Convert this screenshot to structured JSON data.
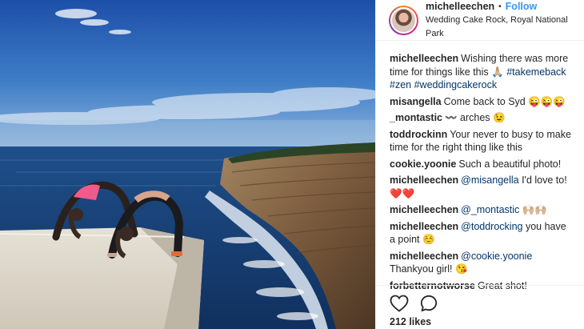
{
  "user": {
    "username": "michelleechen",
    "separator": "•",
    "follow_label": "Follow",
    "location": "Wedding Cake Rock, Royal National Park"
  },
  "comments": [
    {
      "user": "michelleechen",
      "parts": [
        {
          "t": "Wishing there was more time for things like this "
        },
        {
          "t": "🙏🏼"
        },
        {
          "t": " "
        },
        {
          "t": "#takemeback",
          "tag": true
        },
        {
          "t": " "
        },
        {
          "t": "#zen",
          "tag": true
        },
        {
          "t": " "
        },
        {
          "t": "#weddingcakerock",
          "tag": true
        }
      ]
    },
    {
      "user": "misangella",
      "parts": [
        {
          "t": "Come back to Syd 😜😜😜"
        }
      ]
    },
    {
      "user": "_montastic",
      "parts": [
        {
          "t": "〰️ arches 😉"
        }
      ]
    },
    {
      "user": "toddrockinn",
      "parts": [
        {
          "t": "Your never to busy to make time for the right thing like this"
        }
      ]
    },
    {
      "user": "cookie.yoonie",
      "parts": [
        {
          "t": "Such a beautiful photo!"
        }
      ]
    },
    {
      "user": "michelleechen",
      "parts": [
        {
          "t": "@misangella",
          "tag": true
        },
        {
          "t": " I'd love to! ❤️❤️"
        }
      ]
    },
    {
      "user": "michelleechen",
      "parts": [
        {
          "t": "@_montastic",
          "tag": true
        },
        {
          "t": " 🙌🏼🙌🏼"
        }
      ]
    },
    {
      "user": "michelleechen",
      "parts": [
        {
          "t": "@toddrocking",
          "tag": true
        },
        {
          "t": " you have a point ☺️"
        }
      ]
    },
    {
      "user": "michelleechen",
      "parts": [
        {
          "t": "@cookie.yoonie",
          "tag": true
        },
        {
          "t": " Thankyou girl! 😘"
        }
      ]
    },
    {
      "user": "forbetternotworse",
      "parts": [
        {
          "t": "Great shot!"
        }
      ]
    }
  ],
  "likes": "212 likes",
  "colors": {
    "link": "#003569",
    "follow": "#3897f0",
    "text": "#262626",
    "border": "#efefef"
  },
  "icons": [
    "heart-icon",
    "comment-icon"
  ]
}
